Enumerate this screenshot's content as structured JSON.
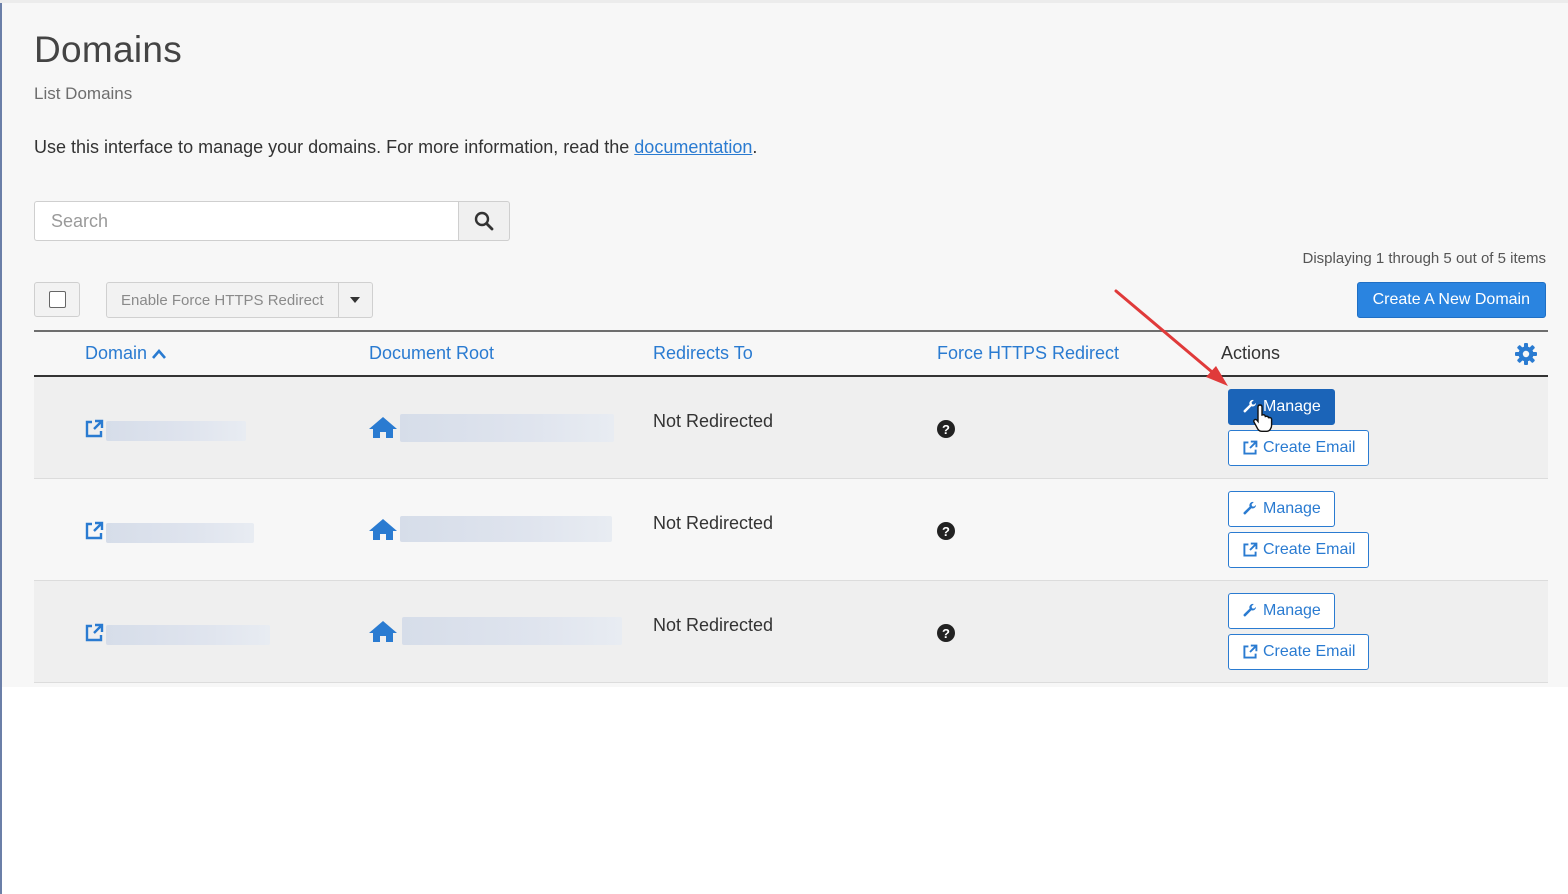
{
  "page": {
    "title": "Domains",
    "subtitle": "List Domains",
    "intro_text": "Use this interface to manage your domains. For more information, read the ",
    "intro_link": "documentation",
    "intro_end": "."
  },
  "search": {
    "placeholder": "Search",
    "icon": "search-icon"
  },
  "toolbar": {
    "display_info": "Displaying 1 through 5 out of 5 items",
    "bulk_action_label": "Enable Force HTTPS Redirect",
    "create_label": "Create A New Domain"
  },
  "table": {
    "headers": {
      "domain": "Domain",
      "document_root": "Document Root",
      "redirects_to": "Redirects To",
      "force_https": "Force HTTPS Redirect",
      "actions": "Actions"
    },
    "rows": [
      {
        "redirects": "Not Redirected",
        "manage_label": "Manage",
        "create_email_label": "Create Email"
      },
      {
        "redirects": "Not Redirected",
        "manage_label": "Manage",
        "create_email_label": "Create Email"
      },
      {
        "redirects": "Not Redirected",
        "manage_label": "Manage",
        "create_email_label": "Create Email"
      }
    ]
  },
  "colors": {
    "accent": "#2a7bd1",
    "primary_button": "#2a84e0",
    "active_manage": "#1b64b8",
    "annotation_arrow": "#e03a3a"
  },
  "icons": [
    "external-link-icon",
    "home-icon",
    "question-circle-icon",
    "wrench-icon",
    "gear-icon",
    "chevron-up-icon",
    "caret-down-icon",
    "pointer-hand-icon"
  ]
}
